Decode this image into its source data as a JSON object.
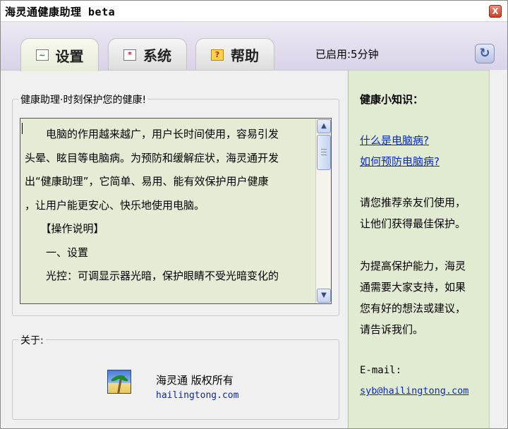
{
  "window": {
    "title": "海灵通健康助理 beta",
    "close_label": "X"
  },
  "tabs": [
    {
      "label": "设置",
      "icon": "chart-icon",
      "active": true
    },
    {
      "label": "系统",
      "icon": "system-icon",
      "active": false
    },
    {
      "label": "帮助",
      "icon": "help-icon",
      "active": false
    }
  ],
  "status": {
    "uptime": "已启用:5分钟"
  },
  "main": {
    "group_title": "健康助理·时刻保护您的健康!",
    "text_lines": [
      "　　电脑的作用越来越广，用户长时间使用，容易引发",
      "头晕、眩目等电脑病。为预防和缓解症状，海灵通开发",
      "出“健康助理”，它简单、易用、能有效保护用户健康",
      "，让用户能更安心、快乐地使用电脑。",
      "　　【操作说明】",
      "　　一、设置",
      "　　光控：可调显示器光暗，保护眼睛不受光暗变化的"
    ],
    "about": {
      "title": "关于:",
      "copyright": "海灵通 版权所有",
      "website": "hailingtong.com"
    }
  },
  "sidebar": {
    "title": "健康小知识：",
    "links": [
      "什么是电脑病?",
      "如何预防电脑病?"
    ],
    "paragraphs": [
      [
        "请您推荐亲友们使用，",
        "让他们获得最佳保护。"
      ],
      [
        "为提高保护能力，海灵",
        "通需要大家支持，如果",
        "您有好的想法或建议，",
        "请告诉我们。"
      ]
    ],
    "email_label": "E-mail:",
    "email": "syb@hailingtong.com"
  },
  "colors": {
    "tab_strip": "#d9d3e8",
    "text_background": "#e4ecd6",
    "side_background": "#e0ebd2",
    "link": "#0a28c8"
  }
}
